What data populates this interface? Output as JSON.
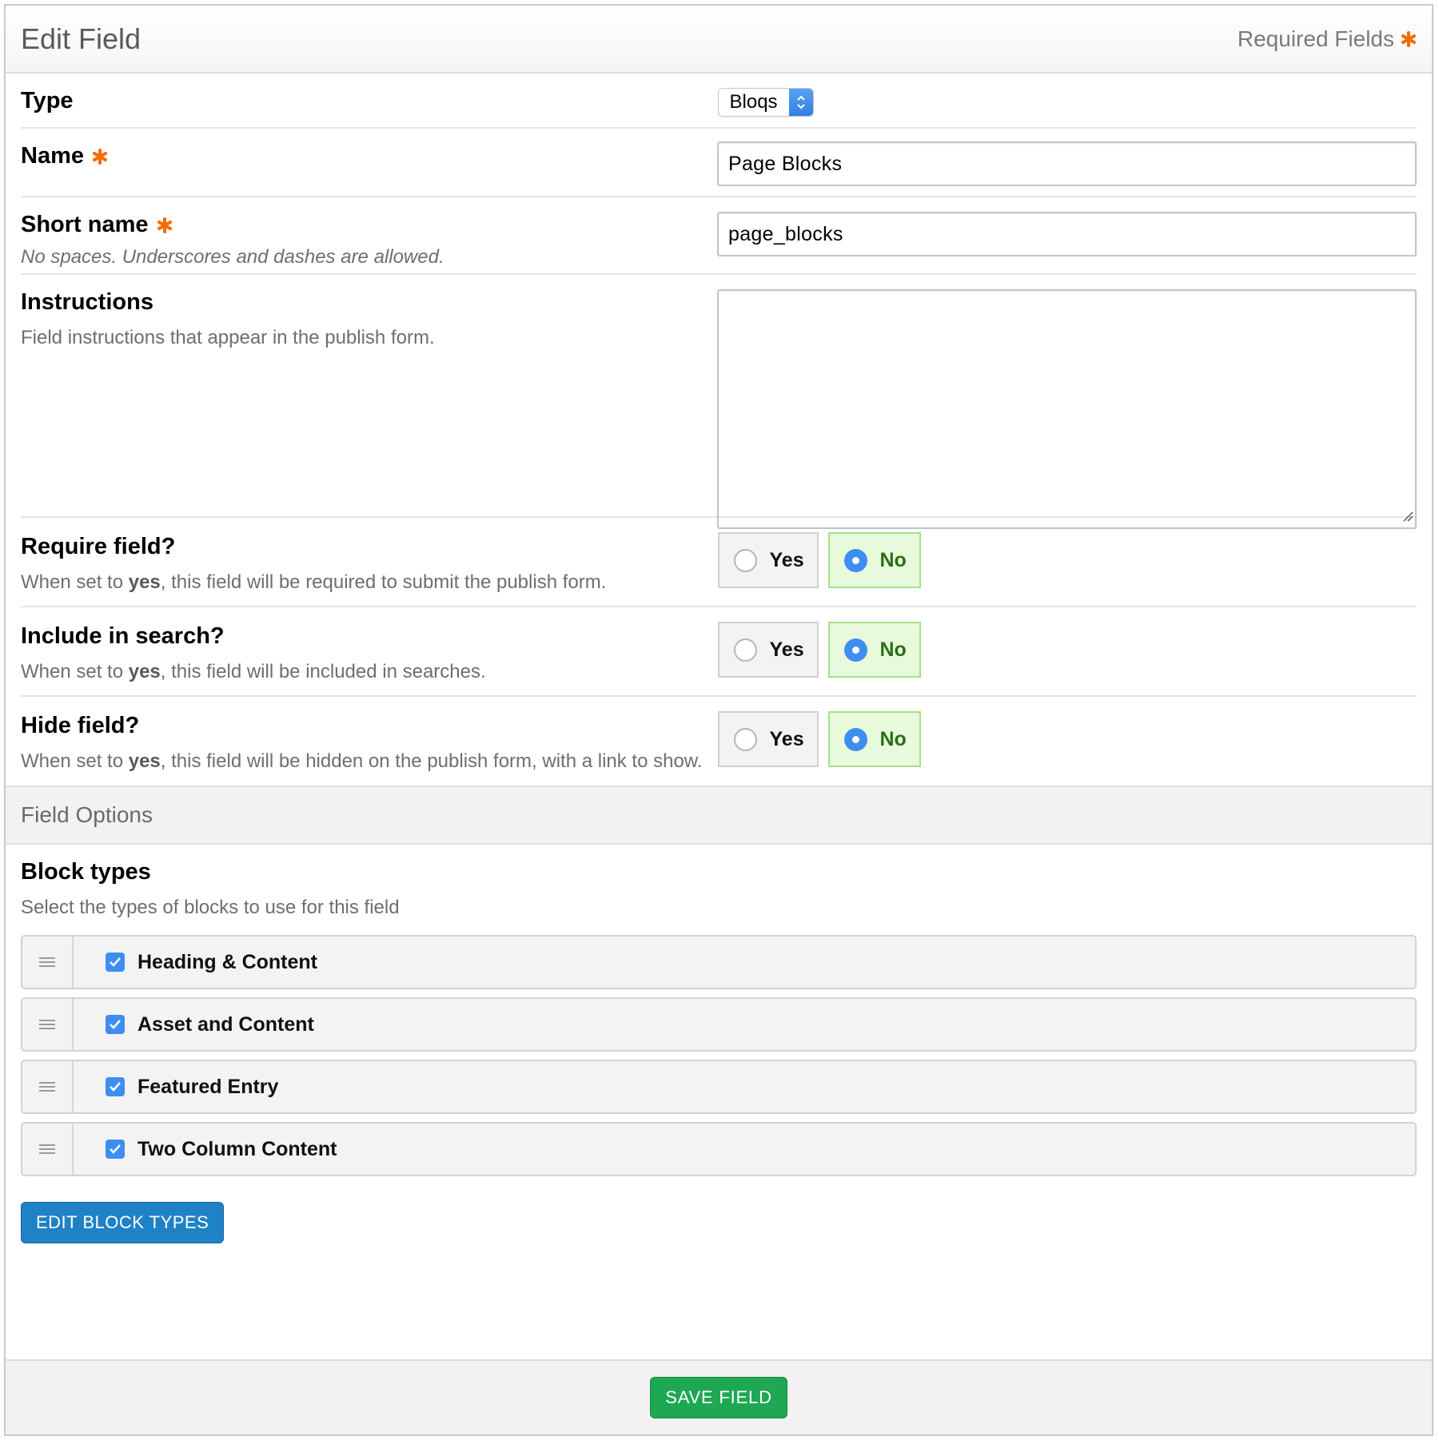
{
  "header": {
    "title": "Edit Field",
    "required_note": "Required Fields"
  },
  "fields": {
    "type": {
      "label": "Type",
      "selected": "Bloqs"
    },
    "name": {
      "label": "Name",
      "value": "Page Blocks"
    },
    "short_name": {
      "label": "Short name",
      "help": "No spaces. Underscores and dashes are allowed.",
      "value": "page_blocks"
    },
    "instructions": {
      "label": "Instructions",
      "help": "Field instructions that appear in the publish form.",
      "value": ""
    },
    "require_field": {
      "label": "Require field?",
      "help_prefix": "When set to ",
      "help_bold": "yes",
      "help_suffix": ", this field will be required to submit the publish form.",
      "yes_label": "Yes",
      "no_label": "No",
      "selected": "No"
    },
    "include_search": {
      "label": "Include in search?",
      "help_prefix": "When set to ",
      "help_bold": "yes",
      "help_suffix": ", this field will be included in searches.",
      "yes_label": "Yes",
      "no_label": "No",
      "selected": "No"
    },
    "hide_field": {
      "label": "Hide field?",
      "help_prefix": "When set to ",
      "help_bold": "yes",
      "help_suffix": ", this field will be hidden on the publish form, with a link to show.",
      "yes_label": "Yes",
      "no_label": "No",
      "selected": "No"
    }
  },
  "field_options": {
    "section_title": "Field Options",
    "block_types": {
      "label": "Block types",
      "help": "Select the types of blocks to use for this field",
      "items": [
        {
          "label": "Heading & Content",
          "checked": true
        },
        {
          "label": "Asset and Content",
          "checked": true
        },
        {
          "label": "Featured Entry",
          "checked": true
        },
        {
          "label": "Two Column Content",
          "checked": true
        }
      ]
    },
    "edit_button": "EDIT BLOCK TYPES"
  },
  "footer": {
    "save_button": "SAVE FIELD"
  },
  "colors": {
    "required_asterisk": "#f36b00",
    "selected_radio_bg": "#e7fadb",
    "primary_blue": "#1f82c6",
    "save_green": "#1ea853",
    "checkbox_blue": "#3d8ef0"
  }
}
